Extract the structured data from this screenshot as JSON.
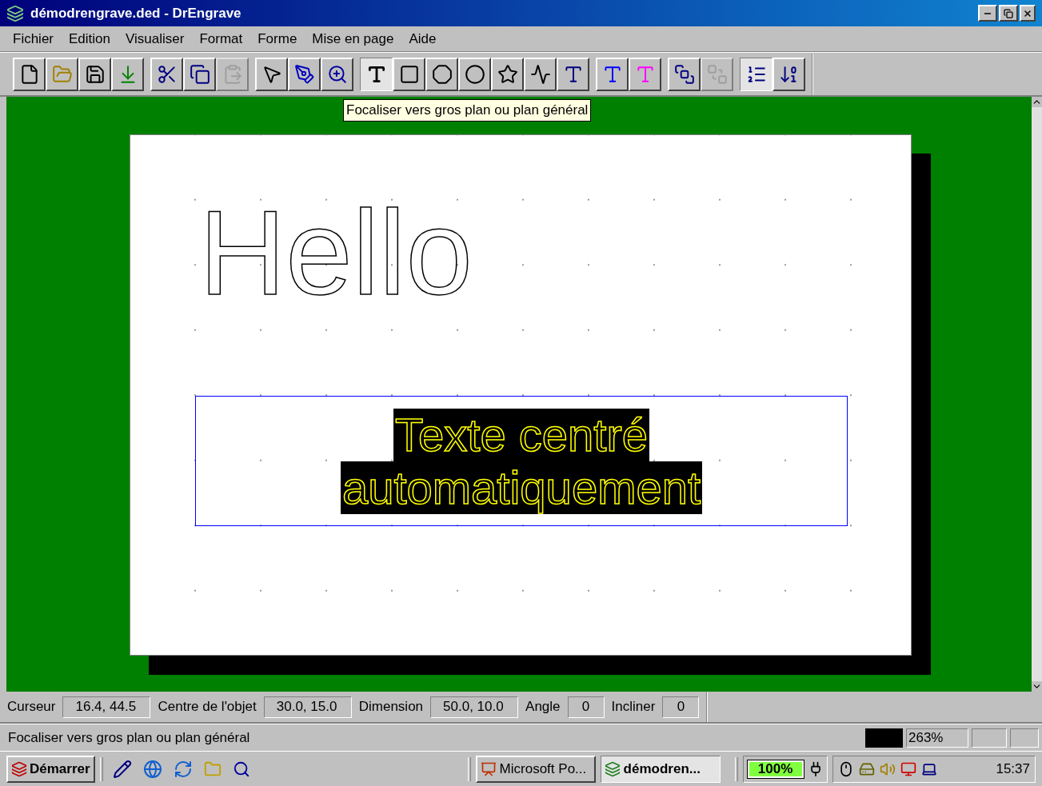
{
  "window": {
    "title": "démodrengrave.ded - DrEngrave"
  },
  "menu": [
    "Fichier",
    "Edition",
    "Visualiser",
    "Format",
    "Forme",
    "Mise en page",
    "Aide"
  ],
  "toolbar": [
    [
      {
        "pressed": false,
        "disabled": false
      },
      {
        "pressed": false,
        "disabled": false
      },
      {
        "pressed": false,
        "disabled": false
      },
      {
        "pressed": false,
        "disabled": false
      }
    ],
    [
      {
        "pressed": false,
        "disabled": false
      },
      {
        "pressed": false,
        "disabled": false
      },
      {
        "pressed": false,
        "disabled": true
      }
    ],
    [
      {
        "pressed": false,
        "disabled": false
      },
      {
        "pressed": false,
        "disabled": false
      },
      {
        "pressed": false,
        "disabled": false
      }
    ],
    [
      {
        "pressed": true,
        "disabled": false
      },
      {
        "pressed": false,
        "disabled": false
      },
      {
        "pressed": false,
        "disabled": false
      },
      {
        "pressed": false,
        "disabled": false
      },
      {
        "pressed": false,
        "disabled": false
      },
      {
        "pressed": false,
        "disabled": false
      },
      {
        "pressed": false,
        "disabled": false
      }
    ],
    [
      {
        "pressed": false,
        "disabled": false
      },
      {
        "pressed": false,
        "disabled": false
      }
    ],
    [
      {
        "pressed": false,
        "disabled": false
      },
      {
        "pressed": false,
        "disabled": true
      }
    ],
    [
      {
        "pressed": true,
        "disabled": false
      },
      {
        "pressed": false,
        "disabled": false
      }
    ]
  ],
  "tooltip": "Focaliser vers gros plan ou plan général",
  "canvas": {
    "hello_text": "Hello",
    "text_box": {
      "lines": [
        "Texte centré",
        "automatiquement"
      ],
      "selected": true
    }
  },
  "coordinates": [
    {
      "label": "Curseur",
      "value": "16.4, 44.5"
    },
    {
      "label": "Centre de l'objet",
      "value": "30.0, 15.0"
    },
    {
      "label": "Dimension",
      "value": "50.0, 10.0"
    },
    {
      "label": "Angle",
      "value": "0"
    },
    {
      "label": "Incliner",
      "value": "0"
    }
  ],
  "status_bar": {
    "message": "Focaliser vers gros plan ou plan général",
    "color": "#000000",
    "zoom": "263%"
  },
  "taskbar": {
    "start": "Démarrer",
    "tasks": [
      {
        "label": "Microsoft Po...",
        "selected": false
      },
      {
        "label": "démodren...",
        "selected": true
      }
    ],
    "battery": {
      "reading": "100%",
      "level": 1
    },
    "clock": "15:37"
  }
}
